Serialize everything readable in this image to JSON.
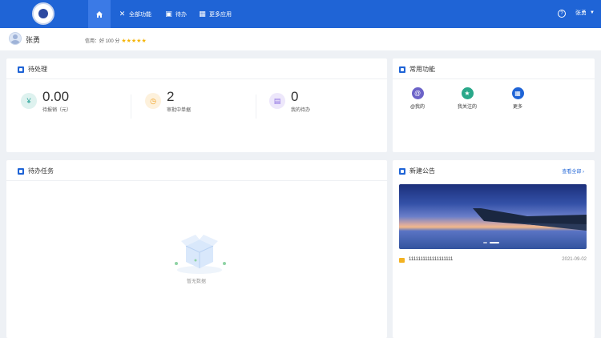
{
  "nav": {
    "items": [
      {
        "label": "全部功能",
        "icon": "tools-icon"
      },
      {
        "label": "待办",
        "icon": "todo-icon"
      },
      {
        "label": "更多应用",
        "icon": "apps-icon"
      }
    ],
    "home_icon": "home-icon",
    "help_icon": "help-icon",
    "user": "张勇",
    "caret": "▼"
  },
  "profile": {
    "name": "张勇",
    "credit": "信用：好 100 分",
    "stars": "★★★★★",
    "star_rating": 5
  },
  "pending": {
    "title": "待处理",
    "stats": [
      {
        "value": "0.00",
        "label": "待报销（元）",
        "icon": "reimburse-icon",
        "color": "#2ba39a",
        "bg": "#def2ef"
      },
      {
        "value": "2",
        "label": "审批中单据",
        "icon": "clock-icon",
        "color": "#f0a020",
        "bg": "#fdf1dc"
      },
      {
        "value": "0",
        "label": "我的待办",
        "icon": "calendar-icon",
        "color": "#8a6de0",
        "bg": "#ede7fb"
      }
    ]
  },
  "common": {
    "title": "常用功能",
    "items": [
      {
        "label": "@我的",
        "icon": "at-icon",
        "color": "#6c63c8"
      },
      {
        "label": "我关注的",
        "icon": "star-icon",
        "color": "#2aa88a"
      },
      {
        "label": "更多",
        "icon": "grid-icon",
        "color": "#1f64d6"
      }
    ]
  },
  "tasks": {
    "title": "待办任务",
    "empty": "暂无数据"
  },
  "notice": {
    "title": "新建公告",
    "more": "查看全部 ›",
    "items": [
      {
        "text": "1111111111111111111",
        "date": "2021-09-02"
      }
    ]
  },
  "colors": {
    "brand": "#1f64d6",
    "background": "#eef1f5"
  }
}
